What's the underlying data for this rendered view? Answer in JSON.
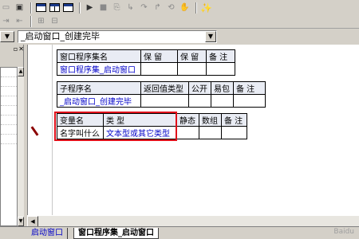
{
  "toolbar": {
    "row1": [
      "open",
      "window",
      "window-split",
      "window-both",
      "run",
      "stop",
      "step",
      "step-into",
      "step-over",
      "step-out",
      "breakpoint",
      "magic"
    ],
    "row2": [
      "indent",
      "outdent",
      "compile",
      "properties"
    ]
  },
  "module_selector": {
    "value": "_启动窗口_创建完毕"
  },
  "table_assembly": {
    "headers": [
      "窗口程序集名",
      "保 留",
      "保 留",
      "备 注"
    ],
    "row": [
      "窗口程序集_启动窗口",
      "",
      "",
      ""
    ]
  },
  "table_subroutine": {
    "headers": [
      "子程序名",
      "返回值类型",
      "公开",
      "易包",
      "备 注"
    ],
    "row": [
      "_启动窗口_创建完毕",
      "",
      "",
      "",
      ""
    ]
  },
  "table_variable": {
    "headers": [
      "变量名",
      "类 型",
      "静态",
      "数组",
      "备 注"
    ],
    "row": [
      "名字叫什么",
      "文本型或其它类型",
      "",
      "",
      ""
    ]
  },
  "tabs": {
    "tab1": "启动窗口",
    "tab2": "窗口程序集_启动窗口"
  },
  "watermark": "Baidu",
  "colors": {
    "highlight": "#e0101a",
    "link_text": "#0000c8"
  }
}
